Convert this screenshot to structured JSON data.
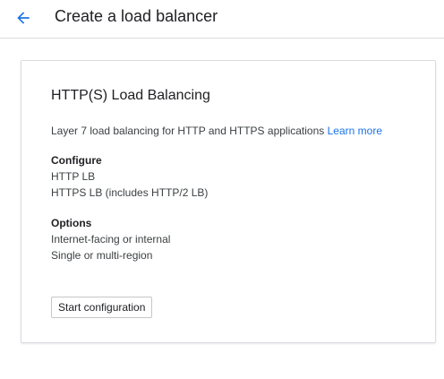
{
  "header": {
    "back_icon": "arrow-left-icon",
    "title": "Create a load balancer"
  },
  "card": {
    "title": "HTTP(S) Load Balancing",
    "description": "Layer 7 load balancing for HTTP and HTTPS applications",
    "learn_more": "Learn more",
    "configure": {
      "heading": "Configure",
      "items": [
        "HTTP LB",
        "HTTPS LB (includes HTTP/2 LB)"
      ]
    },
    "options": {
      "heading": "Options",
      "items": [
        "Internet-facing or internal",
        "Single or multi-region"
      ]
    },
    "start_label": "Start configuration"
  },
  "colors": {
    "accent": "#1a73e8",
    "border": "#dadce0",
    "text": "#202124"
  }
}
